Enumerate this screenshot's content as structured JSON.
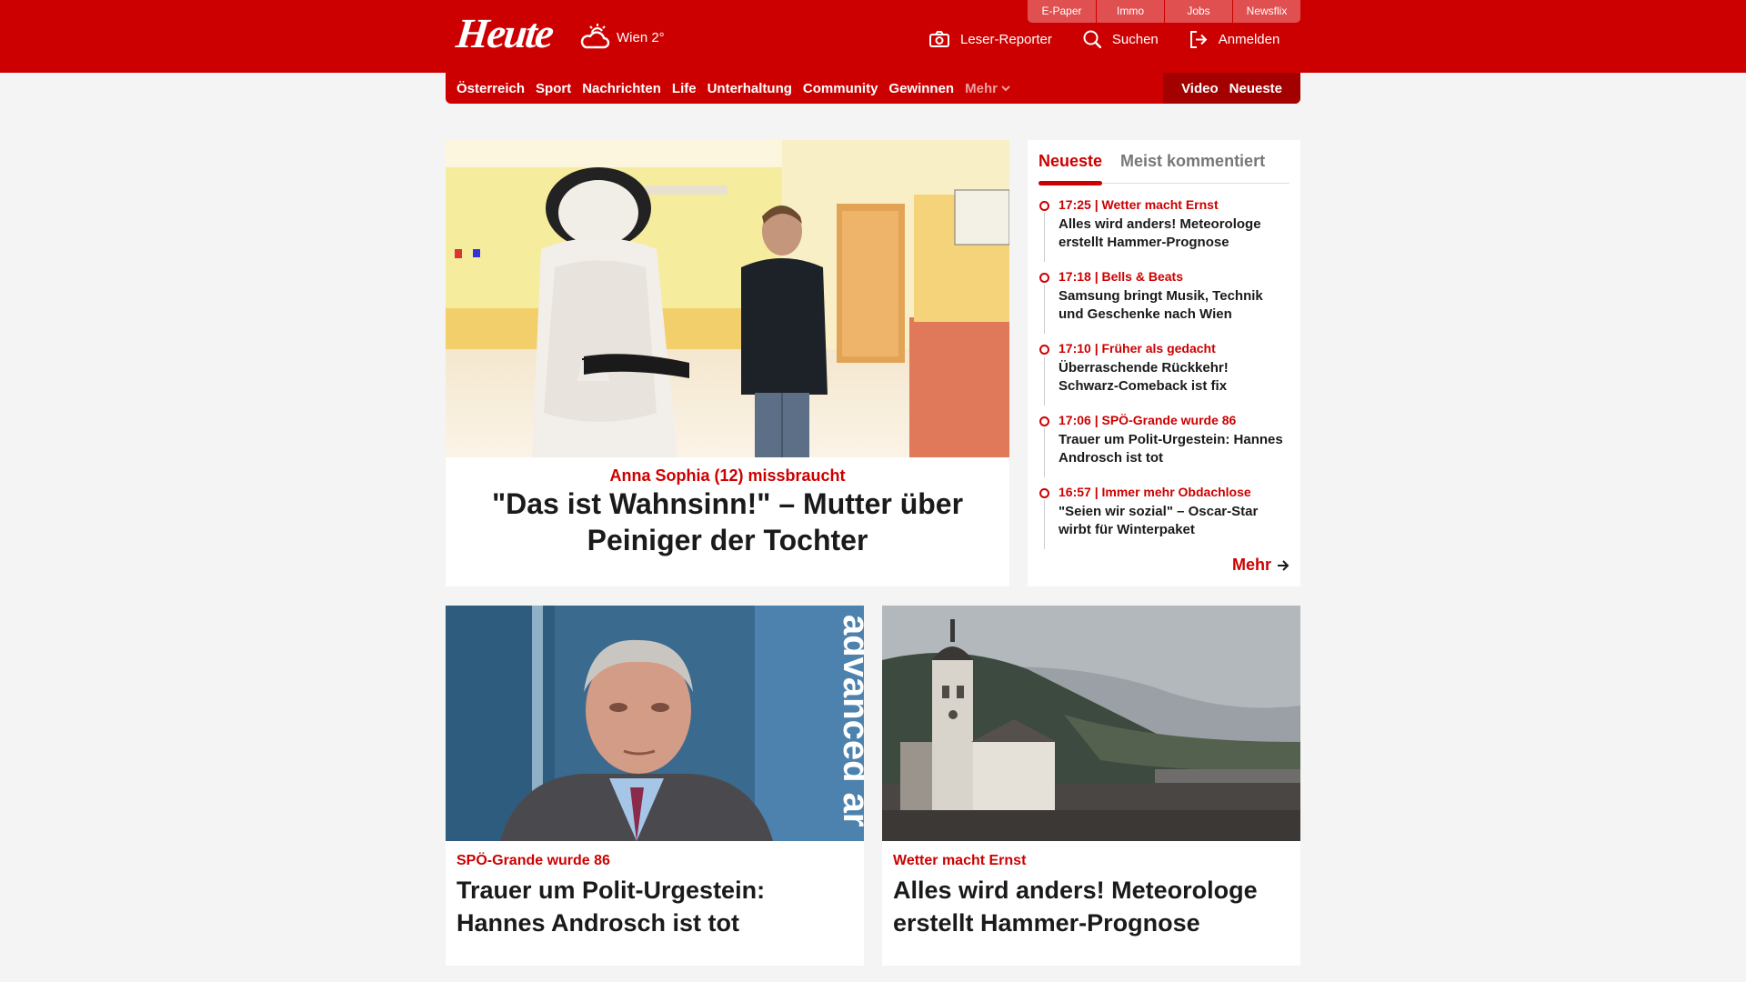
{
  "header": {
    "logo": "Heute",
    "weather": {
      "icon": "cloud-sun-icon",
      "label": "Wien 2°"
    },
    "quicklinks": [
      "E-Paper",
      "Immo",
      "Jobs",
      "Newsflix"
    ],
    "actions": [
      {
        "icon": "camera-icon",
        "label": "Leser-Reporter"
      },
      {
        "icon": "search-icon",
        "label": "Suchen"
      },
      {
        "icon": "login-icon",
        "label": "Anmelden"
      }
    ]
  },
  "nav": {
    "items": [
      "Österreich",
      "Sport",
      "Nachrichten",
      "Life",
      "Unterhaltung",
      "Community",
      "Gewinnen"
    ],
    "more_label": "Mehr",
    "right": [
      "Video",
      "Neueste"
    ]
  },
  "hero": {
    "kicker": "Anna Sophia (12) missbraucht",
    "title": "\"Das ist Wahnsinn!\" – Mutter über Peiniger der Tochter"
  },
  "sidebar": {
    "tabs": [
      "Neueste",
      "Meist kommentiert"
    ],
    "items": [
      {
        "meta": "17:25 | Wetter macht Ernst",
        "title": "Alles wird anders! Meteorologe erstellt Hammer-Prognose"
      },
      {
        "meta": "17:18 | Bells & Beats",
        "title": "Samsung bringt Musik, Technik und Geschenke nach Wien"
      },
      {
        "meta": "17:10 | Früher als gedacht",
        "title": "Überraschende Rückkehr! Schwarz-Comeback ist fix"
      },
      {
        "meta": "17:06 | SPÖ-Grande wurde 86",
        "title": "Trauer um Polit-Urgestein: Hannes Androsch ist tot"
      },
      {
        "meta": "16:57 | Immer mehr Obdachlose",
        "title": "\"Seien wir sozial\" – Oscar-Star wirbt für Winterpaket"
      }
    ],
    "more_label": "Mehr"
  },
  "cards": [
    {
      "kicker": "SPÖ-Grande wurde 86",
      "title": "Trauer um Polit-Urgestein: Hannes Androsch ist tot",
      "image_text": "advanced ar"
    },
    {
      "kicker": "Wetter macht Ernst",
      "title": "Alles wird anders! Meteorologe erstellt Hammer-Prognose"
    }
  ],
  "colors": {
    "brand": "#cc0000",
    "brand_dark": "#a30000",
    "background": "#f4f4f4"
  }
}
